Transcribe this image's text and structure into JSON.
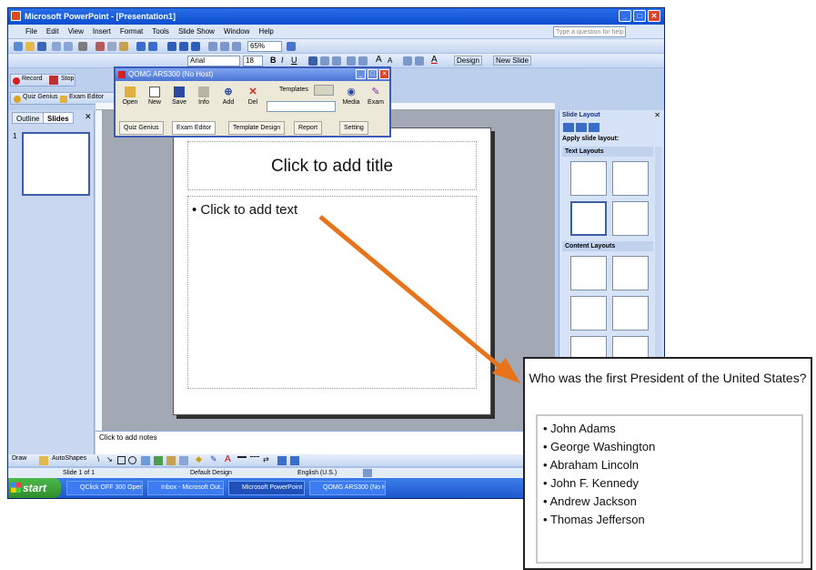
{
  "window": {
    "title": "Microsoft PowerPoint - [Presentation1]"
  },
  "menu": [
    "File",
    "Edit",
    "View",
    "Insert",
    "Format",
    "Tools",
    "Slide Show",
    "Window",
    "Help"
  ],
  "help_box": "Type a question for help",
  "toolbar": {
    "zoom": "65%",
    "font_name": "Arial",
    "font_size": "18",
    "design_label": "Design",
    "new_slide_label": "New Slide"
  },
  "record_toolbar": {
    "record_label": "Record",
    "stop_label": "Stop"
  },
  "quiz_toolbar": {
    "quiz_genius": "Quiz Genius",
    "exam_editor": "Exam Editor"
  },
  "outline_pane": {
    "tabs": [
      "Outline",
      "Slides"
    ],
    "slide_number": "1"
  },
  "slide": {
    "title_placeholder": "Click to add title",
    "body_placeholder": "Click to add text"
  },
  "notes_placeholder": "Click to add notes",
  "layout_pane": {
    "title": "Slide Layout",
    "apply_label": "Apply slide layout:",
    "section_text": "Text Layouts",
    "section_content": "Content Layouts"
  },
  "status": {
    "slide": "Slide 1 of 1",
    "design": "Default Design",
    "language": "English (U.S.)"
  },
  "drawbar": {
    "draw_label": "Draw",
    "autoshapes_label": "AutoShapes"
  },
  "taskbar": {
    "start": "start",
    "tasks": [
      "QClick OFF 300 Oper...",
      "Inbox - Microsoft Out...",
      "Microsoft PowerPoint ...",
      "QOMG ARS300 (No H..."
    ],
    "clock": ""
  },
  "dialog": {
    "title": "QOMG ARS300 (No Host)",
    "buttons": [
      "Open",
      "New",
      "Save",
      "Info",
      "Add",
      "Del",
      "Media",
      "Exam"
    ],
    "templates_label": "Templates",
    "tabs": [
      "Quiz Genius",
      "Exam Editor",
      "Template Design",
      "Report",
      "Setting"
    ]
  },
  "callout": {
    "question": "Who was the first President of the United States?",
    "answers": [
      "John Adams",
      "George Washington",
      "Abraham Lincoln",
      "John F. Kennedy",
      "Andrew Jackson",
      "Thomas Jefferson"
    ]
  },
  "colors": {
    "arrow": "#e8731a",
    "titlebar": "#0b4fd1",
    "taskbar": "#1f58d0",
    "start": "#2e8e2c"
  }
}
